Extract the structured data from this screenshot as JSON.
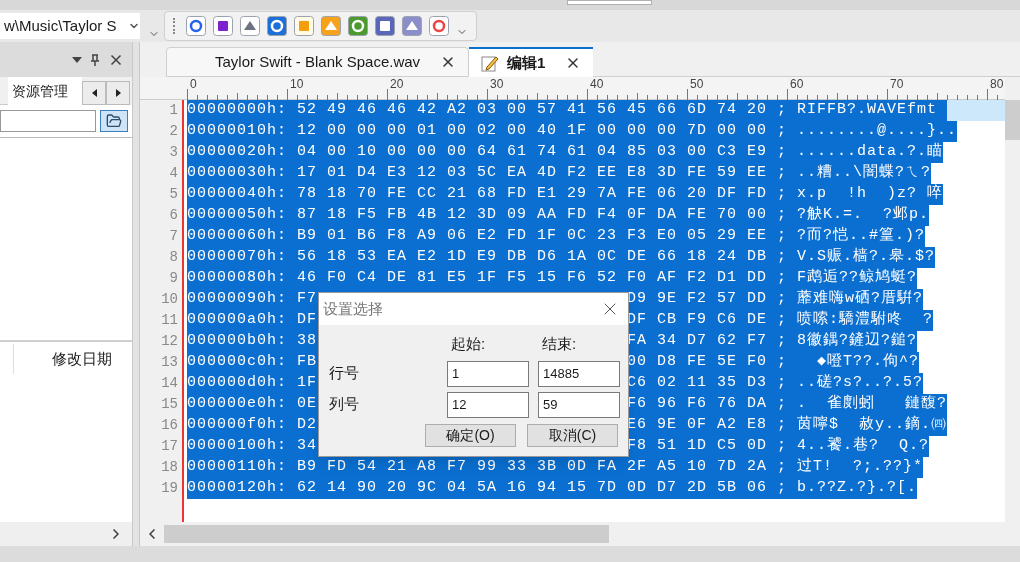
{
  "address_bar": {
    "value": "w\\Music\\Taylor S"
  },
  "side_panel": {
    "tabs": [
      {
        "label": "资源管理",
        "selected": true
      }
    ],
    "columns": [
      "修改日期"
    ]
  },
  "tabs": [
    {
      "label": "Taylor Swift - Blank Space.wav",
      "selected": false,
      "kind": "file"
    },
    {
      "label": "编辑1",
      "selected": true,
      "kind": "edit"
    }
  ],
  "ruler": {
    "labels": [
      "0",
      "10",
      "20",
      "30",
      "40",
      "50",
      "60",
      "70",
      "80"
    ]
  },
  "lines": [
    {
      "number": "1",
      "text": "00000000h: 52 49 46 46 42 A2 03 00 57 41 56 45 66 6D 74 20 ; RIFFB?.WAVEfmt ",
      "selected": true,
      "current": true
    },
    {
      "number": "2",
      "text": "00000010h: 12 00 00 00 01 00 02 00 40 1F 00 00 00 7D 00 00 ; ........@....}..",
      "selected": true,
      "current": false
    },
    {
      "number": "3",
      "text": "00000020h: 04 00 10 00 00 00 64 61 74 61 04 85 03 00 C3 E9 ; ......data.?.瞄",
      "selected": true,
      "current": false
    },
    {
      "number": "4",
      "text": "00000030h: 17 01 D4 E3 12 03 5C EA 4D F2 EE E8 3D FE 59 EE ; ..糟..\\闇蝶?ㄟ?",
      "selected": true,
      "current": false
    },
    {
      "number": "5",
      "text": "00000040h: 78 18 70 FE CC 21 68 FD E1 29 7A FE 06 20 DF FD ; x.p  !h  )z? 啐",
      "selected": true,
      "current": false
    },
    {
      "number": "6",
      "text": "00000050h: 87 18 F5 FB 4B 12 3D 09 AA FD F4 0F DA FE 70 00 ; ?觖K.=.  ?邺p.",
      "selected": true,
      "current": false
    },
    {
      "number": "7",
      "text": "00000060h: B9 01 B6 F8 A9 06 E2 FD 1F 0C 23 F3 E0 05 29 EE ; ?而?恺..#篁.)?",
      "selected": true,
      "current": false
    },
    {
      "number": "8",
      "text": "00000070h: 56 18 53 EA E2 1D E9 DB D6 1A 0C DE 66 18 24 DB ; V.S赈.樯?.皋.$?",
      "selected": true,
      "current": false
    },
    {
      "number": "9",
      "text": "00000080h: 46 F0 C4 DE 81 E5 1F F5 15 F6 52 F0 AF F2 D1 DD ; F鹉逅??鲸鸠蜓?",
      "selected": true,
      "current": false
    },
    {
      "number": "10",
      "text": "00000090h: F7",
      "text_right": "D9 9E F2 57 DD ; 蘼难嗨w硒?厝騈?",
      "selected": true,
      "current": false
    },
    {
      "number": "11",
      "text": "000000a0h: DF",
      "text_right": "DF CB F9 C6 DE ; 喷嗦:驕澧駙咚  ?",
      "selected": true,
      "current": false
    },
    {
      "number": "12",
      "text": "000000b0h: 38",
      "text_right": "FA 34 D7 62 F7 ; 8徽鍝?鏟辺?鎚?",
      "selected": true,
      "current": false
    },
    {
      "number": "13",
      "text": "000000c0h: FB",
      "text_right": "00 D8 FE 5E F0 ;   ◆噔T??.佝^?",
      "selected": true,
      "current": false
    },
    {
      "number": "14",
      "text": "000000d0h: 1F",
      "text_right": "C6 02 11 35 D3 ; ..磋?s?..?.5?",
      "selected": true,
      "current": false
    },
    {
      "number": "15",
      "text": "000000e0h: 0E",
      "text_right": "F6 96 F6 76 DA ; .  雀剫蚓   鏈馥?",
      "selected": true,
      "current": false
    },
    {
      "number": "16",
      "text": "000000f0h: D2",
      "text_right": "E6 9E 0F A2 E8 ; 茵嚀$  赦y..鏑.㈣",
      "selected": true,
      "current": false
    },
    {
      "number": "17",
      "text": "00000100h: 34",
      "text_right": "F8 51 1D C5 0D ; 4..饕.巷?  Q.?",
      "selected": true,
      "current": false
    },
    {
      "number": "18",
      "text": "00000110h: B9 FD 54 21 A8 F7 99 33 3B 0D FA 2F A5 10 7D 2A ; 过T!  ?;.??}*",
      "selected": true,
      "current": false
    },
    {
      "number": "19",
      "text": "00000120h: 62 14 90 20 9C 04 5A 16 94 15 7D 0D D7 2D 5B 06 ; b.??Z.?}.?[.",
      "selected": true,
      "current": false
    }
  ],
  "dialog": {
    "title": "设置选择",
    "column_headers": [
      "起始:",
      "结束:"
    ],
    "rows": [
      {
        "label": "行号",
        "start": "1",
        "end": "14885"
      },
      {
        "label": "列号",
        "start": "12",
        "end": "59"
      }
    ],
    "buttons": [
      "确定(O)",
      "取消(C)"
    ]
  }
}
